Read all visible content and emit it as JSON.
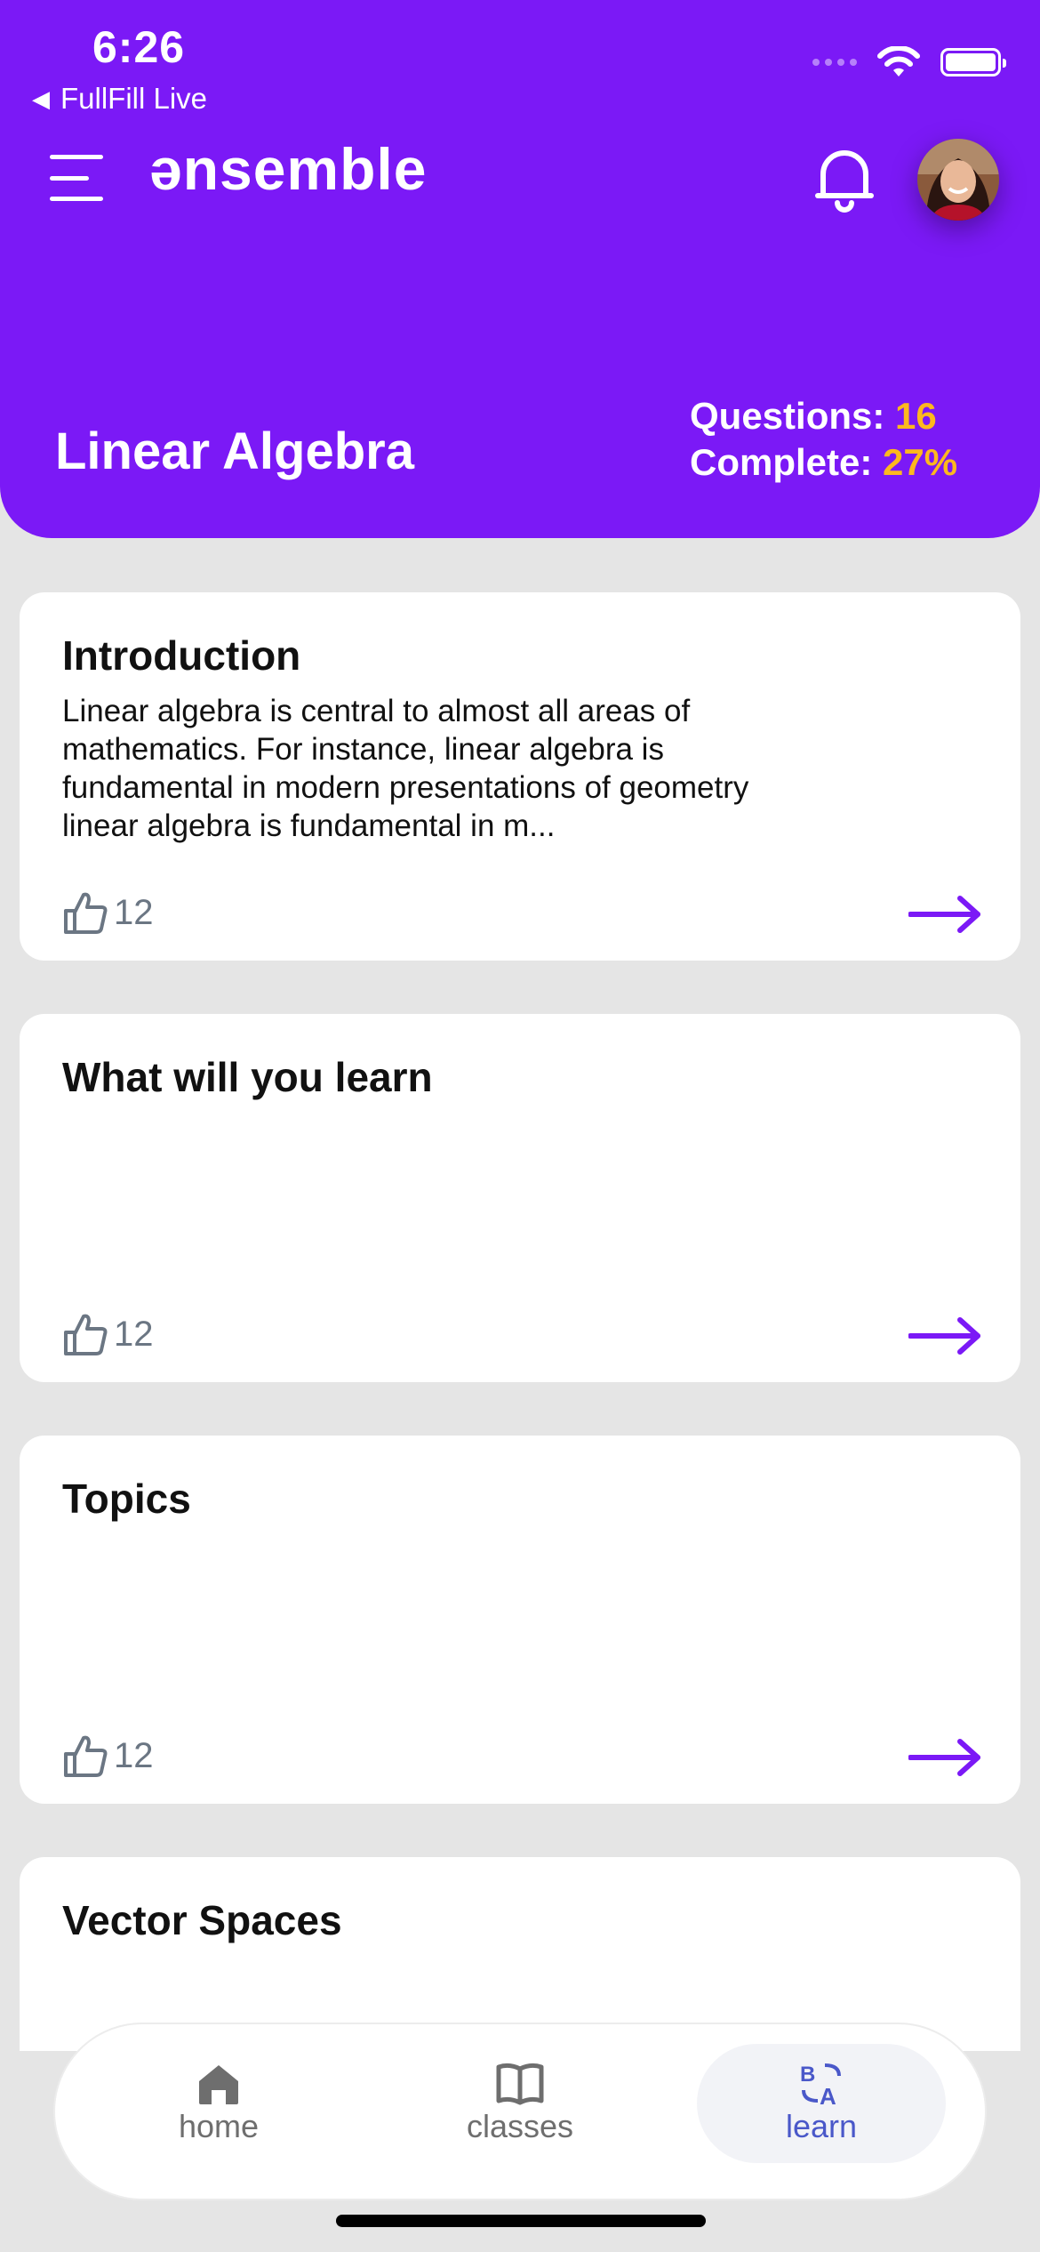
{
  "status_bar": {
    "time": "6:26",
    "back_app": "FullFill Live"
  },
  "header": {
    "logo": "ənsemble",
    "title": "Linear Algebra",
    "questions_label": "Questions:",
    "questions_value": "16",
    "complete_label": "Complete:",
    "complete_value": "27%"
  },
  "colors": {
    "brand": "#7b19f6",
    "accent": "#fdb81e",
    "nav_active": "#4a58c9"
  },
  "cards": [
    {
      "title": "Introduction",
      "description": "Linear algebra is central to almost all areas of mathematics. For instance, linear algebra is fundamental in modern presentations of geometry linear algebra is fundamental in m...",
      "likes": "12"
    },
    {
      "title": "What will you learn",
      "description": "",
      "likes": "12"
    },
    {
      "title": "Topics",
      "description": "",
      "likes": "12"
    },
    {
      "title": "Vector Spaces",
      "description": ""
    }
  ],
  "bottom_nav": {
    "items": [
      {
        "label": "home",
        "icon": "home-icon"
      },
      {
        "label": "classes",
        "icon": "book-icon"
      },
      {
        "label": "learn",
        "icon": "translate-icon",
        "active": true
      }
    ]
  }
}
